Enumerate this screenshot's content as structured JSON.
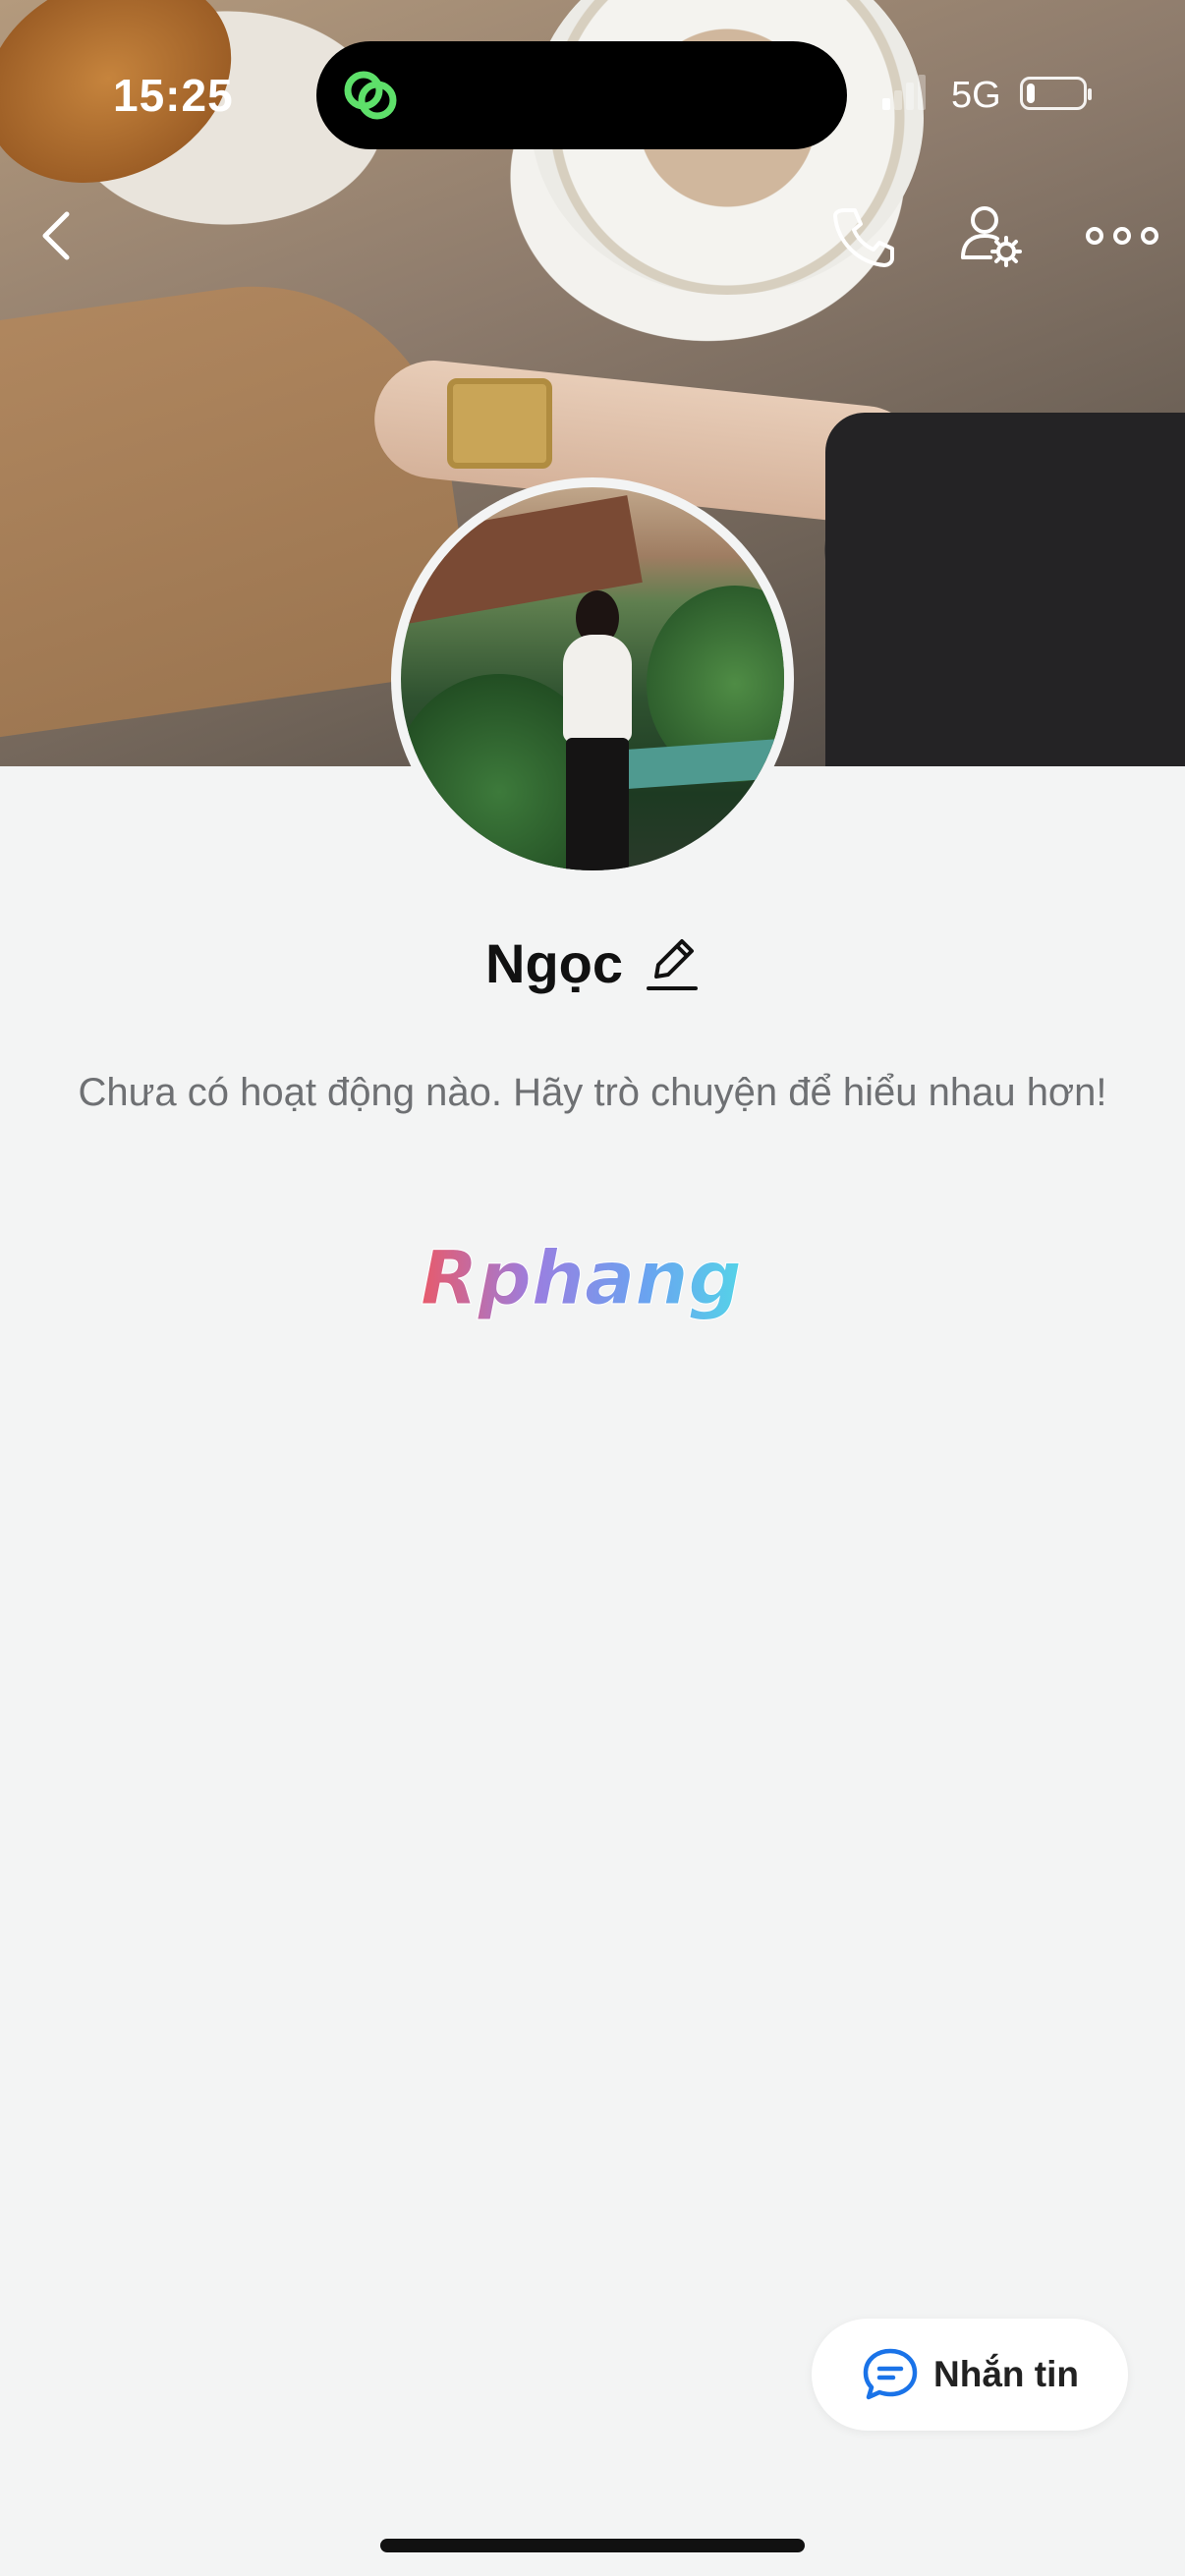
{
  "status_bar": {
    "time": "15:25",
    "network": "5G",
    "battery_level": 0.15
  },
  "profile": {
    "name": "Ngọc",
    "empty_activity_text": "Chưa có hoạt động nào. Hãy trò chuyện để hiểu nhau hơn!"
  },
  "watermark": {
    "text": "Rphang"
  },
  "actions": {
    "message_label": "Nhắn tin"
  },
  "icons": {
    "back": "chevron-left-icon",
    "call": "phone-icon",
    "profile_settings": "user-gear-icon",
    "more": "more-dots-icon",
    "edit": "pencil-icon",
    "chat": "chat-bubble-icon"
  },
  "colors": {
    "accent": "#1a73e8",
    "island_icon": "#5ee06a",
    "background": "#f3f4f4"
  }
}
